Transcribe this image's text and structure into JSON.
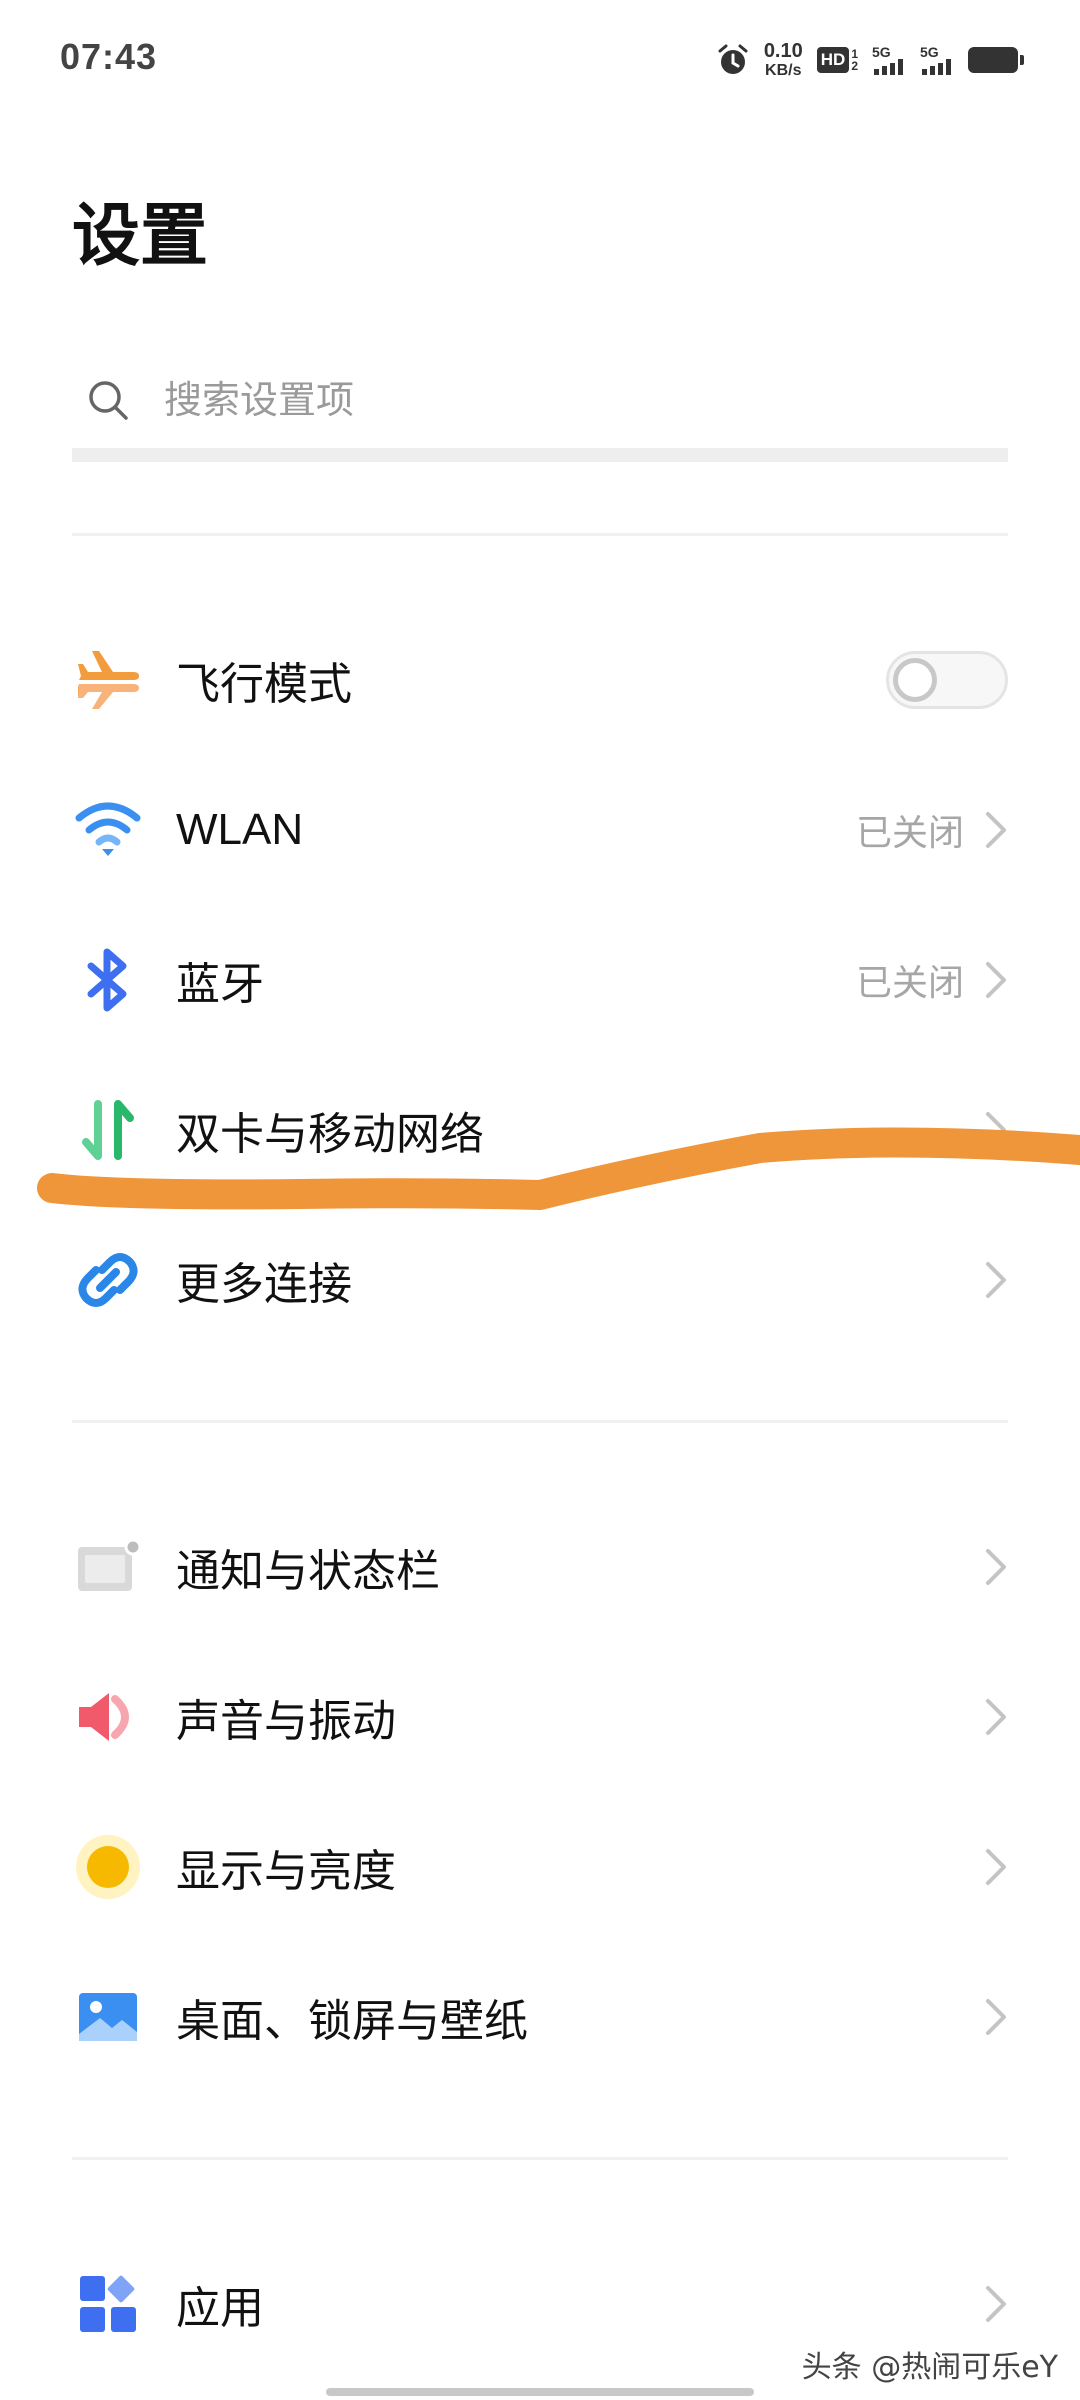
{
  "status_bar": {
    "time": "07:43",
    "net_speed_value": "0.10",
    "net_speed_unit": "KB/s",
    "hd_label": "HD",
    "hd_top": "1",
    "hd_bottom": "2",
    "sim1_network": "5G",
    "sim2_network": "5G",
    "icons": [
      "alarm-icon",
      "hd-voice-icon",
      "signal-icon",
      "battery-icon"
    ]
  },
  "page": {
    "title": "设置"
  },
  "search": {
    "placeholder": "搜索设置项"
  },
  "items": [
    {
      "label": "飞行模式",
      "icon": "airplane-icon",
      "toggle_on": false
    },
    {
      "label": "WLAN",
      "value": "已关闭",
      "icon": "wifi-icon"
    },
    {
      "label": "蓝牙",
      "value": "已关闭",
      "icon": "bluetooth-icon"
    },
    {
      "label": "双卡与移动网络",
      "icon": "mobile-data-icon"
    },
    {
      "label": "更多连接",
      "icon": "link-icon"
    },
    {
      "label": "通知与状态栏",
      "icon": "notification-icon"
    },
    {
      "label": "声音与振动",
      "icon": "speaker-icon"
    },
    {
      "label": "显示与亮度",
      "icon": "brightness-icon"
    },
    {
      "label": "桌面、锁屏与壁纸",
      "icon": "wallpaper-icon"
    },
    {
      "label": "应用",
      "icon": "apps-icon"
    }
  ],
  "colors": {
    "airplane": "#f39c3d",
    "wifi": "#3a8ff0",
    "bluetooth": "#3d6ff0",
    "mobile_data": "#29b86a",
    "link": "#2a87e8",
    "speaker": "#f05a6a",
    "brightness": "#f7b800",
    "wallpaper": "#3a8ff0",
    "apps": "#3d6ff0",
    "annotation_stroke": "#f0963a"
  },
  "watermark": "头条 @热闹可乐eY"
}
